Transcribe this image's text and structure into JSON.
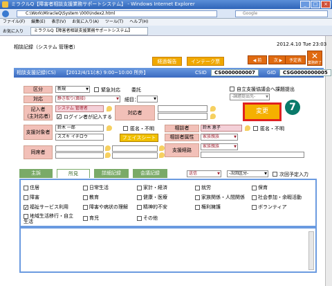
{
  "browser": {
    "title": "ミラクルQ【障害者相談支援業務サポートシステム】 - Windows Internet Explorer",
    "address": "C:\\Work\\MiracleQ\\System \\000\\index2.html",
    "search_placeholder": "Google",
    "menu": [
      "ファイル(F)",
      "編集(E)",
      "表示(V)",
      "お気に入り(A)",
      "ツール(T)",
      "ヘルプ(H)"
    ],
    "favorites": "お気に入り",
    "tab": "ミラクルQ【障害者相談支援業務サポートシステム】"
  },
  "header": {
    "title": "相談記録（システム 管理者）",
    "date": "2012.4.10 Tue 23:03",
    "report_btn": "経過報告",
    "intake_btn": "インテーク票",
    "back_btn": "前",
    "next_btn": "次",
    "list_btn": "予定表",
    "close_btn": "業務終了"
  },
  "recordbar": {
    "label": "相談支援記録(CS)",
    "datetime": "【2012/4/11(木) 9:00~10:00 所外】",
    "csid_label": "CSID",
    "csid": "CS0000000007",
    "gid_label": "GID",
    "gid": "CSG0000000005"
  },
  "form": {
    "kubun_label": "区分",
    "kubun_value": "新規",
    "emergency": "緊急対応",
    "commission": "委託",
    "jiritsu": "自立支援協議会へ課題提出",
    "jiritsu_select": "-課題提出先-",
    "taiou_label": "対応",
    "taiou_value": "静き取り(面接)",
    "detail_label": "細目：",
    "kinyusha_label": "記入者\n（主対応者）",
    "kinyusha_value": "システム 管理者",
    "login_check": "ログイン者が記入する",
    "taiousha_label": "対応者",
    "change_btn": "変更",
    "badge": "7",
    "shienshasha_label": "支援対象者",
    "shien_name": "鈴木 一郎",
    "shien_kana": "スズキ イチロウ",
    "tokumei": "匿名・不明",
    "facesheet_btn": "フェイスシート",
    "soudansha_label": "相談者",
    "soudansha_value": "鈴木 恵子",
    "tokumei2": "匿名・不明",
    "zokusei_label": "相談者属性",
    "zokusei_value": "家族親族",
    "keiro_label": "支援経路",
    "keiro_value": "家族親族",
    "doukyo_label": "同席者"
  },
  "tabs": {
    "main": "主訴",
    "shoken": "所見",
    "detail": "詳細記録",
    "meeting": "会議記録",
    "sender": "送信",
    "next_plan": "-次回区分-",
    "next_input": "次回予定入力"
  },
  "checks": [
    {
      "label": "住居",
      "on": false
    },
    {
      "label": "日常生活",
      "on": false
    },
    {
      "label": "家計・経済",
      "on": false
    },
    {
      "label": "就労",
      "on": false
    },
    {
      "label": "保育",
      "on": false
    },
    {
      "label": "障害",
      "on": false
    },
    {
      "label": "教育",
      "on": false
    },
    {
      "label": "健康・医療",
      "on": false
    },
    {
      "label": "家族関係・人間関係",
      "on": false
    },
    {
      "label": "社会参加・余暇活動",
      "on": false
    },
    {
      "label": "福祉サービス利用",
      "on": true
    },
    {
      "label": "障害や病状の理解",
      "on": false
    },
    {
      "label": "精神的不安",
      "on": false
    },
    {
      "label": "権利擁護",
      "on": false
    },
    {
      "label": "ボランティア",
      "on": false
    },
    {
      "label": "地域生活移行・自立\n生活",
      "on": false
    },
    {
      "label": "育児",
      "on": false
    },
    {
      "label": "その他",
      "on": false
    }
  ]
}
